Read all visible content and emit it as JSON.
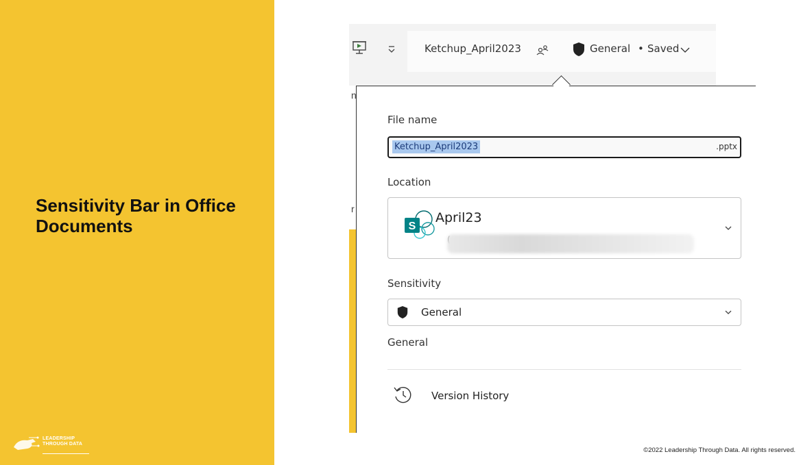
{
  "slide": {
    "title": "Sensitivity Bar in Office Documents",
    "logo_text": "LEADERSHIP THROUGH DATA",
    "footer": "©2022 Leadership Through Data. All rights reserved."
  },
  "titlebar": {
    "document_name": "Ketchup_April2023",
    "sensitivity_label": "General",
    "separator": "•",
    "save_status": "Saved"
  },
  "background_fragments": {
    "a": "n",
    "b": "r"
  },
  "dropdown": {
    "file_name_label": "File name",
    "file_name_value": "Ketchup_April2023",
    "file_extension": ".pptx",
    "location_label": "Location",
    "location_name": "April23",
    "location_path_prefix": "(",
    "sensitivity_label": "Sensitivity",
    "sensitivity_value": "General",
    "sensitivity_description": "General",
    "version_history_label": "Version History"
  },
  "colors": {
    "accent_yellow": "#f4c430",
    "selection_highlight": "#a9c8ee",
    "sharepoint_teal": "#038387"
  },
  "icons": {
    "present": "present-icon",
    "qat_customize": "customize-qat-icon",
    "coauthor": "people-icon",
    "shield": "shield-icon",
    "chevron": "chevron-down-icon",
    "sharepoint": "sharepoint-icon",
    "history": "history-icon"
  }
}
